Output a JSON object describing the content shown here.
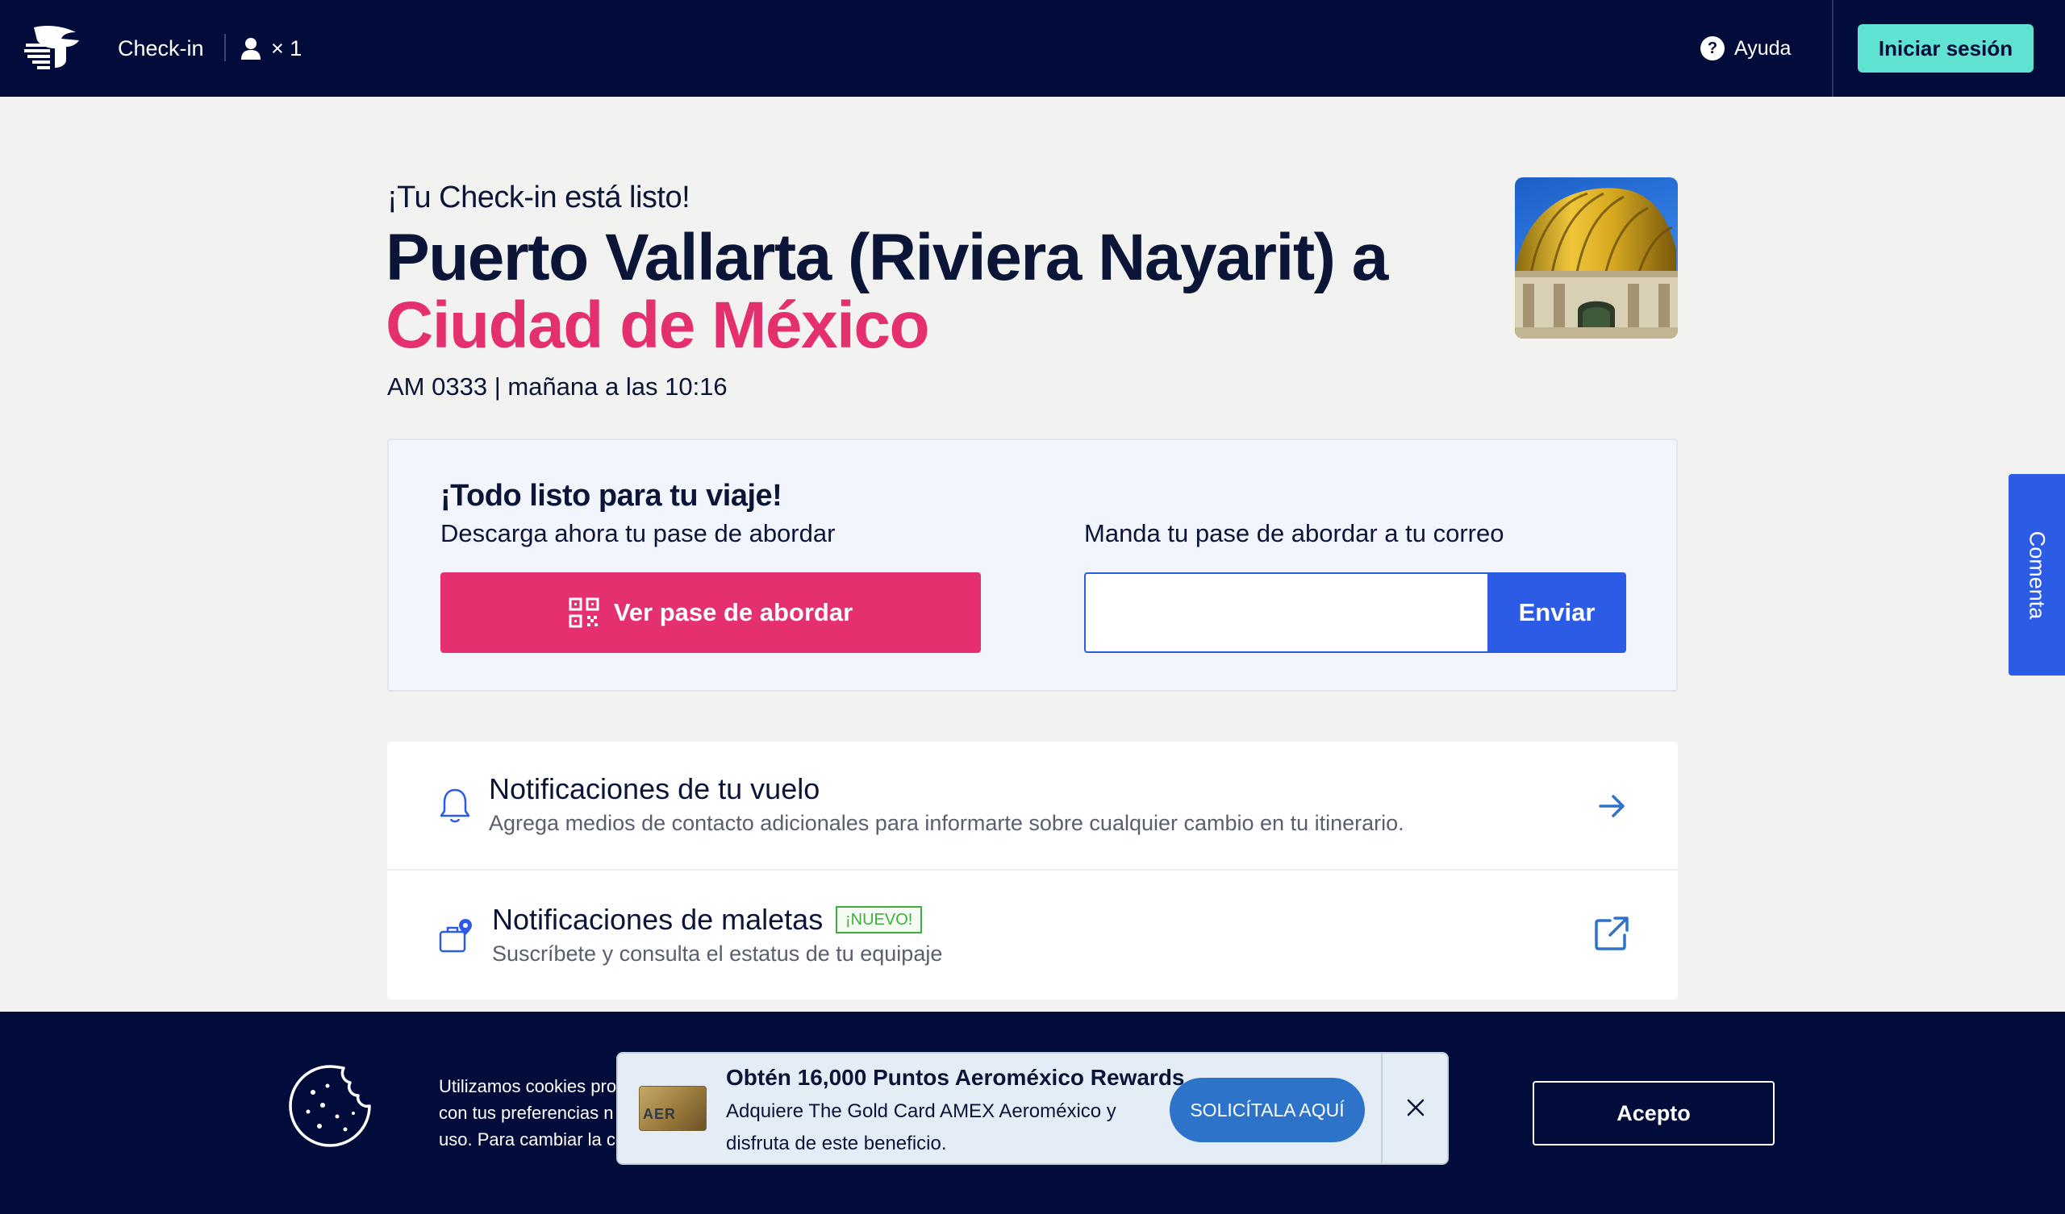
{
  "header": {
    "nav_label": "Check-in",
    "passenger_count": "× 1",
    "help_label": "Ayuda",
    "help_icon_glyph": "?",
    "login_label": "Iniciar sesión"
  },
  "hero": {
    "ready_text": "¡Tu Check-in está listo!",
    "origin_line": "Puerto Vallarta (Riviera Nayarit) a",
    "destination": "Ciudad de México",
    "flight_info": "AM 0333 | mañana a las 10:16"
  },
  "boarding": {
    "title": "¡Todo listo para tu viaje!",
    "subtitle": "Descarga ahora tu pase de abordar",
    "view_pass_label": "Ver pase de abordar",
    "email_label": "Manda tu pase de abordar a tu correo",
    "email_value": "",
    "send_label": "Enviar"
  },
  "notifications": [
    {
      "title": "Notificaciones de tu vuelo",
      "description": "Agrega medios de contacto adicionales para informarte sobre cualquier cambio en tu itinerario.",
      "icon": "bell-icon",
      "action_icon": "arrow-right-icon"
    },
    {
      "title": "Notificaciones de maletas",
      "badge": "¡NUEVO!",
      "description": "Suscríbete y consulta el estatus de tu equipaje",
      "icon": "luggage-location-icon",
      "action_icon": "external-link-icon"
    }
  ],
  "feedback_tab": "Comenta",
  "cookies": {
    "line1": "Utilizamos cookies pro",
    "line1_tail": "a",
    "line2": "con tus preferencias n",
    "line3": "uso. Para cambiar la co",
    "accept_label": "Acepto"
  },
  "promo": {
    "title": "Obtén 16,000 Puntos Aeroméxico Rewards",
    "description": "Adquiere The Gold Card AMEX Aeroméxico y disfruta de este beneficio.",
    "card_text": "AER",
    "cta_label": "SOLICÍTALA AQUÍ"
  },
  "colors": {
    "header_bg": "#020c3a",
    "accent_pink": "#e5306f",
    "accent_blue": "#2c5be6",
    "login_teal": "#5fe2cf",
    "badge_green": "#3fae3c"
  }
}
